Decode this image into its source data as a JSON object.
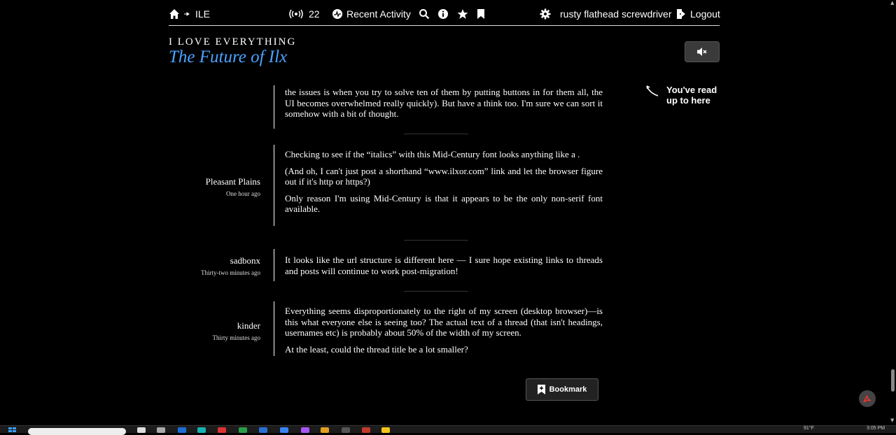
{
  "nav": {
    "board": "ILE",
    "new_count": "22",
    "recent_activity": "Recent Activity",
    "username": "rusty flathead screwdriver",
    "logout": "Logout"
  },
  "header": {
    "site_name": "I LOVE EVERYTHING",
    "thread_title": "The Future of Ilx"
  },
  "read_marker": {
    "text": "You've read up to here"
  },
  "posts": [
    {
      "author": "",
      "time": "",
      "paragraphs": [
        "the issues is when you try to solve ten of them by putting buttons in for them all, the UI becomes overwhelmed really quickly). But have a think too. I'm sure we can sort it somehow with a bit of thought."
      ]
    },
    {
      "author": "Pleasant Plains",
      "time": "One hour ago",
      "paragraphs": [
        "Checking to see if the “italics” with this Mid-Century font looks anything like a                 .",
        "(And oh, I can't just post a shorthand “www.ilxor.com” link and let the browser figure out if it's http or https?)",
        "Only reason I'm using Mid-Century is that it appears to be the only non-serif font available."
      ]
    },
    {
      "author": "sadbonx",
      "time": "Thirty-two minutes ago",
      "paragraphs": [
        "It looks like the url structure is different here — I sure hope existing links to threads and posts will continue to work post-migration!"
      ]
    },
    {
      "author": "kinder",
      "time": "Thirty minutes ago",
      "paragraphs": [
        "Everything seems disproportionately to the right of my screen (desktop browser)—is this what everyone else is seeing too? The actual text of a thread (that isn't headings, usernames etc) is probably about 50% of the width of my screen.",
        "At the least, could the thread title be a lot smaller?"
      ]
    }
  ],
  "bookmark_button": "Bookmark",
  "taskbar": {
    "temp": "91°F",
    "clock": "3:05 PM"
  }
}
